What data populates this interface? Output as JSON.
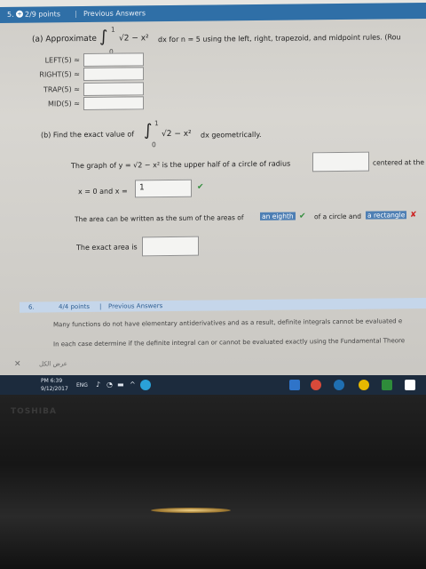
{
  "header": {
    "number": "5.",
    "points": "2/9 points",
    "separator": "|",
    "previous": "Previous Answers"
  },
  "part_a": {
    "prefix": "(a) Approximate",
    "int_upper": "1",
    "int_lower": "0",
    "integrand": "√2 − x²",
    "suffix": "dx  for  n = 5  using the left, right, trapezoid, and midpoint rules. (Rou",
    "rows": [
      "LEFT(5) ≈",
      "RIGHT(5) ≈",
      "TRAP(5) ≈",
      "MID(5) ≈"
    ]
  },
  "part_b": {
    "prefix": "(b) Find the exact value of",
    "int_upper": "1",
    "int_lower": "0",
    "integrand": "√2 − x²",
    "suffix": "dx  geometrically.",
    "graph_line": "The graph of  y = √2 − x²  is the upper half of a circle of radius",
    "centered": "centered at the",
    "x_line_a": "x = 0  and  x =",
    "x_value": "1",
    "area_line": "The area can be written as the sum of the areas of",
    "answer1": "an eighth",
    "mid_text": "of a circle and",
    "answer2": "a rectangle",
    "exact_line": "The exact area is"
  },
  "q6": {
    "number": "6.",
    "points": "4/4 points",
    "separator": "|",
    "previous": "Previous Answers",
    "line1": "Many functions do not have elementary antiderivatives and as a result, definite integrals cannot be evaluated e",
    "line2": "In each case determine if the definite integral can or cannot be evaluated exactly using the Fundamental Theore"
  },
  "arabic_label": "عرض الكل",
  "taskbar": {
    "time": "PM 6:39",
    "date": "9/12/2017",
    "lang": "ENG"
  },
  "brand": "TOSHIBA"
}
